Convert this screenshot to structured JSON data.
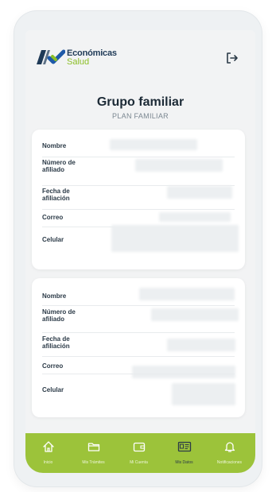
{
  "app": {
    "logo_line1": "Económicas",
    "logo_line2": "Salud"
  },
  "page": {
    "title": "Grupo familiar",
    "subtitle": "PLAN FAMILIAR"
  },
  "members": [
    {
      "labels": {
        "name": "Nombre",
        "affiliate_number": "Número de afiliado",
        "affiliation_date": "Fecha de afiliación",
        "email": "Correo",
        "mobile": "Celular"
      }
    },
    {
      "labels": {
        "name": "Nombre",
        "affiliate_number": "Número de afiliado",
        "affiliation_date": "Fecha de afiliación",
        "email": "Correo",
        "mobile": "Celular"
      }
    }
  ],
  "nav": {
    "items": [
      {
        "label": "Inicio",
        "icon": "home-icon"
      },
      {
        "label": "Mis Trámites",
        "icon": "folder-icon"
      },
      {
        "label": "Mi Cuenta",
        "icon": "wallet-icon"
      },
      {
        "label": "Mis Datos",
        "icon": "id-card-icon"
      },
      {
        "label": "Notificaciones",
        "icon": "bell-icon"
      }
    ]
  },
  "colors": {
    "accent": "#9cc33a",
    "brand_navy": "#1f3a57",
    "brand_green": "#8cbf26"
  }
}
